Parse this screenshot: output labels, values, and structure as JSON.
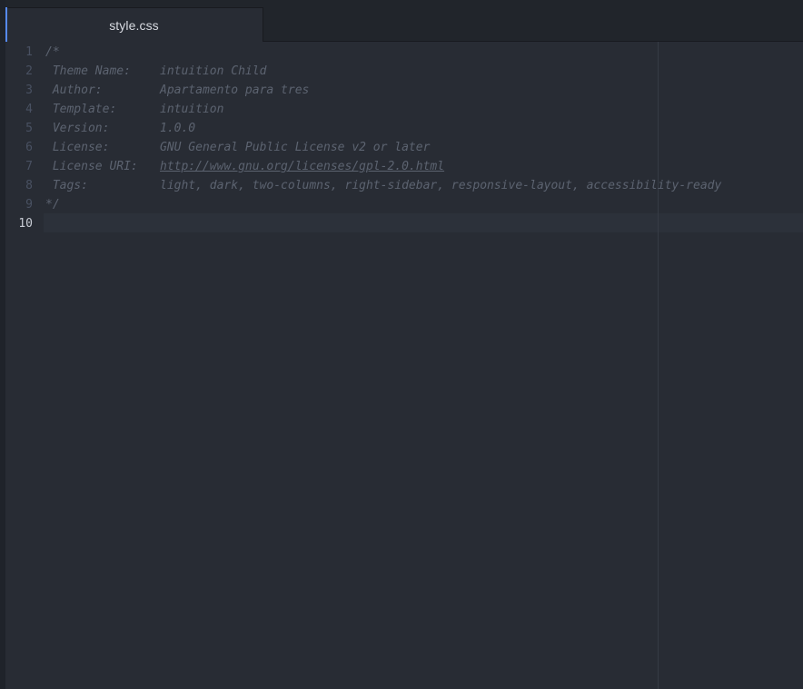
{
  "tab": {
    "title": "style.css"
  },
  "gutter": {
    "line_numbers": [
      "1",
      "2",
      "3",
      "4",
      "5",
      "6",
      "7",
      "8",
      "9",
      "10"
    ]
  },
  "code": {
    "open_comment": "/*",
    "close_comment": "*/",
    "lines": [
      {
        "key": " Theme Name:",
        "value": "intuition Child"
      },
      {
        "key": " Author:",
        "value": "Apartamento para tres"
      },
      {
        "key": " Template:",
        "value": "intuition"
      },
      {
        "key": " Version:",
        "value": "1.0.0"
      },
      {
        "key": " License:",
        "value": "GNU General Public License v2 or later"
      },
      {
        "key": " License URI:",
        "value": "http://www.gnu.org/licenses/gpl-2.0.html"
      },
      {
        "key": " Tags:",
        "value": "light, dark, two-columns, right-sidebar, responsive-layout, accessibility-ready"
      }
    ]
  },
  "colors": {
    "background": "#282c34",
    "comment": "#5c6370",
    "accent": "#568af2"
  }
}
